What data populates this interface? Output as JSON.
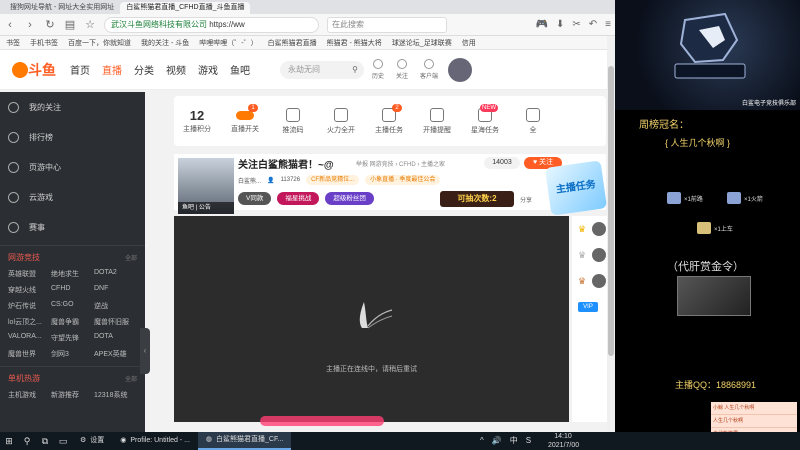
{
  "browser": {
    "tabs": [
      {
        "label": "搜狗网址导航 - 网址大全实用网址"
      },
      {
        "label": "白鲨熊猫君直播_CFHD直播_斗鱼直播"
      }
    ],
    "url_host": "武汉斗鱼网络科技有限公司",
    "url_proto": "https://ww",
    "search_placeholder": "在此搜索",
    "bookmarks": [
      "书签",
      "手机书签",
      "百度一下，你就知道",
      "我的关注 - 斗鱼",
      "哔哩哔哩（゜-゜）",
      "白鲨熊猫君直播",
      "熊猫君 - 熊猫大将",
      "球迷论坛_足球联赛",
      "信用"
    ]
  },
  "douyu": {
    "logo_text": "斗鱼",
    "nav": [
      "首页",
      "直播",
      "分类",
      "视频",
      "游戏",
      "鱼吧"
    ],
    "search_placeholder": "永劫无间",
    "user_icons": [
      "历史",
      "关注",
      "客户端"
    ],
    "sidebar": {
      "items": [
        "我的关注",
        "排行榜",
        "页游中心",
        "云游戏",
        "赛事"
      ],
      "section1_title": "网游竞技",
      "section1_more": "全部",
      "games": [
        "英雄联盟",
        "绝地求生",
        "DOTA2",
        "穿越火线",
        "CFHD",
        "DNF",
        "炉石传说",
        "CS:GO",
        "逆战",
        "lol云顶之...",
        "魔兽争霸",
        "魔兽怀旧服",
        "VALORA...",
        "守望先锋",
        "DOTA",
        "魔兽世界",
        "剑网3",
        "APEX英雄"
      ],
      "section2_title": "单机热游",
      "section2_more": "全部",
      "games2": [
        "主机游戏",
        "新游推荐",
        "12318系统"
      ]
    },
    "tasks": [
      {
        "label": "主播积分",
        "value": "12"
      },
      {
        "label": "直播开关",
        "badge": "1"
      },
      {
        "label": "推流码"
      },
      {
        "label": "火力全开"
      },
      {
        "label": "主播任务",
        "badge": "2"
      },
      {
        "label": "开播提醒"
      },
      {
        "label": "星海任务",
        "badge": "NEW"
      },
      {
        "label": "全"
      }
    ],
    "room": {
      "title": "关注白鲨熊猫君！~@",
      "tags": "举报   网游竞技 › CFHD › 主播之家",
      "id": "14003",
      "follow": "关注",
      "cover_tags": "鱼吧 | 公告",
      "nick": "白鲨熊...",
      "hot": "113726",
      "chip1": "CF新品竞猜位...",
      "chip2": "小象直播 · 季度最佳公会",
      "vip": "V同款",
      "pill1": "福星挑战",
      "pill2": "超级粉丝团",
      "lottery": "可抽次数:2",
      "share": "分享",
      "task_badge": "主播任务"
    },
    "player": {
      "status": "主播正在连线中，请稍后重试"
    }
  },
  "overlay": {
    "team_name": "白鲨电子竞技俱乐部",
    "rank_title": "周榜冠名：",
    "rank_user": "{  人生几个秋啊  }",
    "gifts": [
      {
        "text": "×1前路"
      },
      {
        "text": "×1火箭"
      },
      {
        "text": "×1上车"
      }
    ],
    "reward_title": "（代肝赏金令）",
    "qq": "主播QQ：18868991",
    "giftlist": [
      "小鲸 人生几个秋啊",
      "人生几个秋啊",
      "白鲨熊猫君"
    ]
  },
  "taskbar": {
    "apps": [
      "设置",
      "Profile: Untitled - ...",
      "白鲨熊猫君直播_CF..."
    ],
    "time": "14:10",
    "date": "2021/7/00",
    "ime": "中"
  }
}
